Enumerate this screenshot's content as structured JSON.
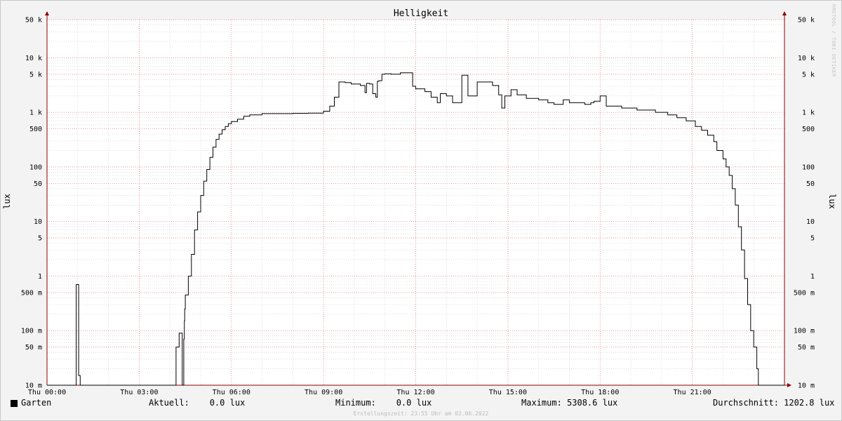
{
  "watermark": "RRDTOOL / TOBI OETIKER",
  "footer": "Erstellungszeit: 23:55 Uhr am 02.06.2022",
  "legend": {
    "series_name": "Garten",
    "current": "Aktuell:    0.0 lux",
    "minimum": "Minimum:    0.0 lux",
    "maximum": "Maximum: 5308.6 lux",
    "average": "Durchschnitt: 1202.8 lux"
  },
  "colors": {
    "line": "#000000",
    "grid_major": "#e07a7a",
    "grid_minor": "#c9c9c9",
    "axis": "#8b0000",
    "plot_bg": "#ffffff"
  },
  "chart_data": {
    "type": "line",
    "title": "Helligkeit",
    "ylabel": "lux",
    "yscale": "log",
    "ylim": [
      0.01,
      50000
    ],
    "xlim": [
      0,
      24
    ],
    "x_ticks": [
      {
        "x": 0,
        "label": "Thu 00:00"
      },
      {
        "x": 3,
        "label": "Thu 03:00"
      },
      {
        "x": 6,
        "label": "Thu 06:00"
      },
      {
        "x": 9,
        "label": "Thu 09:00"
      },
      {
        "x": 12,
        "label": "Thu 12:00"
      },
      {
        "x": 15,
        "label": "Thu 15:00"
      },
      {
        "x": 18,
        "label": "Thu 18:00"
      },
      {
        "x": 21,
        "label": "Thu 21:00"
      }
    ],
    "y_ticks": [
      {
        "y": 0.01,
        "label": "10 m"
      },
      {
        "y": 0.05,
        "label": "50 m"
      },
      {
        "y": 0.1,
        "label": "100 m"
      },
      {
        "y": 0.5,
        "label": "500 m"
      },
      {
        "y": 1,
        "label": "1"
      },
      {
        "y": 5,
        "label": "5"
      },
      {
        "y": 10,
        "label": "10"
      },
      {
        "y": 50,
        "label": "50"
      },
      {
        "y": 100,
        "label": "100"
      },
      {
        "y": 500,
        "label": "500"
      },
      {
        "y": 1000,
        "label": "1 k"
      },
      {
        "y": 5000,
        "label": "5 k"
      },
      {
        "y": 10000,
        "label": "10 k"
      },
      {
        "y": 50000,
        "label": "50 k"
      }
    ],
    "grid": true,
    "series": [
      {
        "x": [
          0,
          0.93,
          0.95,
          0.99,
          1.03,
          1.05,
          1.08,
          1.1,
          4.15,
          4.2,
          4.25,
          4.3,
          4.35,
          4.4,
          4.42,
          4.45,
          4.47,
          4.48,
          4.5,
          4.6,
          4.7,
          4.8,
          4.9,
          5.0,
          5.1,
          5.2,
          5.3,
          5.4,
          5.5,
          5.6,
          5.7,
          5.8,
          5.9,
          6.0,
          6.2,
          6.4,
          6.6,
          7.0,
          7.5,
          8.0,
          8.5,
          9.0,
          9.2,
          9.35,
          9.5,
          9.7,
          9.9,
          10.2,
          10.35,
          10.4,
          10.5,
          10.6,
          10.7,
          10.75,
          10.8,
          10.9,
          11.0,
          11.2,
          11.5,
          11.8,
          11.9,
          12.0,
          12.3,
          12.5,
          12.7,
          12.8,
          13.0,
          13.2,
          13.5,
          13.6,
          13.7,
          14.0,
          14.3,
          14.5,
          14.7,
          14.8,
          14.9,
          15.1,
          15.3,
          15.6,
          16.0,
          16.3,
          16.5,
          16.8,
          17.0,
          17.3,
          17.5,
          17.7,
          17.8,
          18.0,
          18.2,
          18.7,
          19.2,
          19.8,
          20.2,
          20.5,
          20.8,
          21.1,
          21.3,
          21.5,
          21.7,
          21.8,
          22.0,
          22.1,
          22.2,
          22.3,
          22.4,
          22.5,
          22.6,
          22.7,
          22.8,
          22.9,
          23.0,
          23.05,
          23.1,
          23.15,
          24.0
        ],
        "y": [
          0.01,
          0.01,
          0.7,
          0.7,
          0.015,
          0.015,
          0.01,
          0.01,
          0.01,
          0.05,
          0.05,
          0.09,
          0.09,
          0.01,
          0.01,
          0.07,
          0.15,
          0.25,
          0.45,
          1.0,
          2.5,
          7,
          15,
          30,
          55,
          90,
          150,
          230,
          320,
          400,
          480,
          550,
          620,
          680,
          750,
          850,
          900,
          950,
          950,
          960,
          970,
          1050,
          1300,
          1900,
          3600,
          3500,
          3300,
          3100,
          2300,
          3400,
          3300,
          2200,
          1900,
          3700,
          3800,
          5000,
          5100,
          5000,
          5300,
          5300,
          3000,
          2700,
          2400,
          1900,
          1500,
          2200,
          2000,
          1500,
          4800,
          4800,
          2000,
          3600,
          3600,
          3100,
          2100,
          1200,
          2000,
          2600,
          2100,
          1800,
          1700,
          1500,
          1400,
          1700,
          1500,
          1500,
          1400,
          1500,
          1600,
          2000,
          1300,
          1200,
          1100,
          1000,
          900,
          800,
          700,
          550,
          470,
          380,
          290,
          200,
          140,
          100,
          70,
          40,
          20,
          8,
          3,
          0.9,
          0.3,
          0.1,
          0.05,
          0.05,
          0.02,
          0.01,
          0.01
        ]
      }
    ]
  }
}
